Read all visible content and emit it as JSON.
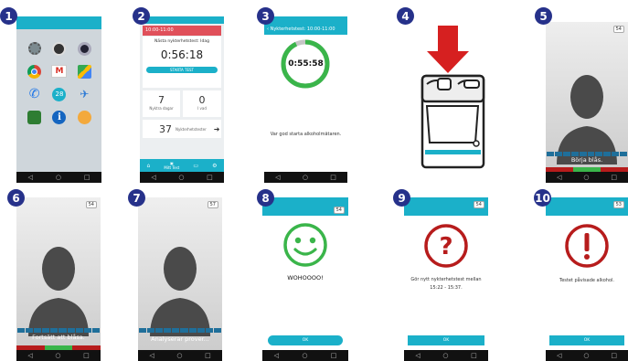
{
  "badges": [
    "1",
    "2",
    "3",
    "4",
    "5",
    "6",
    "7",
    "8",
    "9",
    "10"
  ],
  "sysnav": {
    "back": "◁",
    "home": "○",
    "recent": "□"
  },
  "colors": {
    "teal": "#1bb0c9",
    "green": "#3ab54a",
    "red": "#b71c1c",
    "arrow": "#d62020",
    "badge": "#26318a"
  },
  "screen1": {
    "apps": [
      "settings-icon",
      "dark-app-icon",
      "camera-icon",
      "chrome-icon",
      "gmail-icon",
      "maps-icon",
      "phone-icon",
      "calendar-icon",
      "kayak-icon",
      "app-icon",
      "info-icon",
      "cloud-app-icon"
    ],
    "calendar_day": "28"
  },
  "screen2": {
    "status_time": "10:00-11:00",
    "next_test_label": "Nästa nykterhetstest: Idag",
    "countdown": "0:56:18",
    "start_button": "STARTA TEST",
    "days_value": "7",
    "days_label": "Nyktra dagar",
    "today_value": "0",
    "today_label": "I vad",
    "tests_value": "37",
    "tests_label": "Nykterhetstester",
    "tab_active": "Mitt Test"
  },
  "screen3": {
    "header": "Nykterhetstest: 10:00-11:00",
    "timer": "0:55:58",
    "message": "Var god starta alkoholmätaren.",
    "progress": 0.93
  },
  "screen5": {
    "battery": "54",
    "caption": "Börja blås."
  },
  "screen6": {
    "battery": "54",
    "caption": "Fortsätt att blåsa."
  },
  "screen7": {
    "battery": "57",
    "caption": "Analyserar prover..."
  },
  "screen8": {
    "message": "WOHOOOO!",
    "ok_button": "OK"
  },
  "screen9": {
    "battery": "54",
    "line1": "Gör nytt nykterhetstest mellan",
    "line2": "15:22 - 15:37.",
    "ok_button": "OK"
  },
  "screen10": {
    "battery": "53",
    "message": "Testet påvisade alkohol.",
    "ok_button": "OK"
  }
}
